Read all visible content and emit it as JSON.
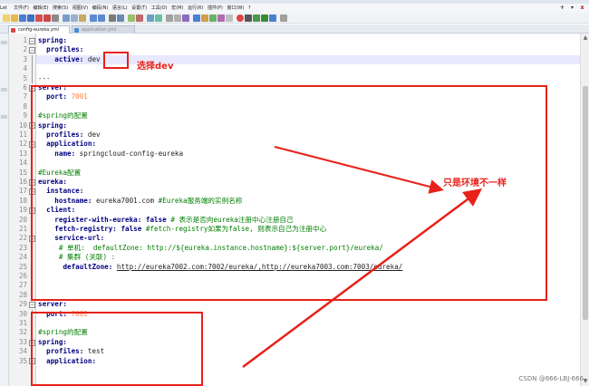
{
  "menu": {
    "left_stub": "Let",
    "items": [
      "文件(F)",
      "编辑(E)",
      "搜索(S)",
      "视图(V)",
      "编码(N)",
      "语言(L)",
      "设置(T)",
      "工具(O)",
      "宏(M)",
      "运行(R)",
      "插件(P)",
      "窗口(W)",
      "?"
    ],
    "window_buttons": [
      "+",
      "▾",
      "x"
    ]
  },
  "tabs": [
    {
      "label": "config-eureka.yml"
    },
    {
      "label": "application.yml"
    }
  ],
  "editor": {
    "lines": [
      {
        "n": "1",
        "fold": "minus"
      },
      {
        "n": "2",
        "fold": "minus"
      },
      {
        "n": "3",
        "fold": "line"
      },
      {
        "n": "4",
        "fold": "line"
      },
      {
        "n": "5",
        "fold": "line"
      },
      {
        "n": "6",
        "fold": "minus"
      },
      {
        "n": "7",
        "fold": "line"
      },
      {
        "n": "8",
        "fold": "line"
      },
      {
        "n": "9",
        "fold": "line"
      },
      {
        "n": "10",
        "fold": "minus"
      },
      {
        "n": "11",
        "fold": "line"
      },
      {
        "n": "12",
        "fold": "minus"
      },
      {
        "n": "13",
        "fold": "line"
      },
      {
        "n": "14",
        "fold": "line"
      },
      {
        "n": "15",
        "fold": "line"
      },
      {
        "n": "16",
        "fold": "minus"
      },
      {
        "n": "17",
        "fold": "minus"
      },
      {
        "n": "18",
        "fold": "line"
      },
      {
        "n": "19",
        "fold": "minus"
      },
      {
        "n": "20",
        "fold": "line"
      },
      {
        "n": "21",
        "fold": "line"
      },
      {
        "n": "22",
        "fold": "minus"
      },
      {
        "n": "23",
        "fold": "line"
      },
      {
        "n": "24",
        "fold": "line"
      },
      {
        "n": "25",
        "fold": "line"
      },
      {
        "n": "26",
        "fold": "line"
      },
      {
        "n": "27",
        "fold": "line"
      },
      {
        "n": "28",
        "fold": "line"
      },
      {
        "n": "29",
        "fold": "minus"
      },
      {
        "n": "30",
        "fold": "line"
      },
      {
        "n": "31",
        "fold": "line"
      },
      {
        "n": "32",
        "fold": "line"
      },
      {
        "n": "33",
        "fold": "minus"
      },
      {
        "n": "34",
        "fold": "line"
      },
      {
        "n": "35",
        "fold": "minus"
      }
    ],
    "code": {
      "l1_key": "spring:",
      "l2_key": "profiles:",
      "l3_key": "active:",
      "l3_val": "dev",
      "l5_sep": "---",
      "l6_key": "server:",
      "l7_key": "port:",
      "l7_val": "7001",
      "l9_comment": "#spring的配置",
      "l10_key": "spring:",
      "l11_key": "profiles:",
      "l11_val": "dev",
      "l12_key": "application:",
      "l13_key": "name:",
      "l13_val": "springcloud-config-eureka",
      "l15_comment": "#Eureka配置",
      "l16_key": "eureka:",
      "l17_key": "instance:",
      "l18_key": "hostname:",
      "l18_val": "eureka7001.com",
      "l18_comment": "#Eureka服务端的实例名称",
      "l19_key": "client:",
      "l20_key": "register-with-eureka:",
      "l20_val": "false",
      "l20_comment": "# 表示是否向eureka注册中心注册自己",
      "l21_key": "fetch-registry:",
      "l21_val": "false",
      "l21_comment": "#fetch-registry如果为false, 则表示自己为注册中心",
      "l22_key": "service-url:",
      "l23_comment": "# 单机:  defaultZone: http://${eureka.instance.hostname}:${server.port}/eureka/",
      "l24_comment": "# 集群 (关联) :",
      "l25_key": "defaultZone:",
      "l25_val": "http://eureka7002.com:7002/eureka/,http://eureka7003.com:7003/eureka/",
      "l29_key": "server:",
      "l30_key": "port:",
      "l30_val": "7001",
      "l32_comment": "#spring的配置",
      "l33_key": "spring:",
      "l34_key": "profiles:",
      "l34_val": "test",
      "l35_key": "application:"
    }
  },
  "annotations": {
    "select_dev": "选择dev",
    "only_env_diff": "只是环境不一样",
    "color": "#e8211a"
  },
  "watermark": "CSDN @666-LBJ-666"
}
